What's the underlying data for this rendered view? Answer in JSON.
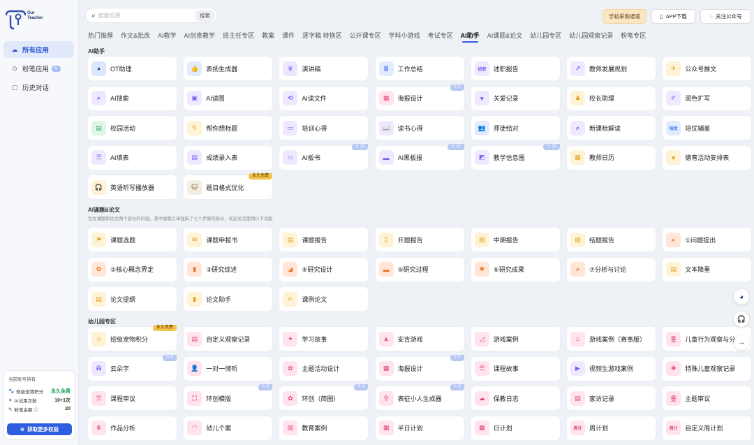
{
  "logo": {
    "line1": "Our",
    "line2": "Teacher"
  },
  "sidebar": {
    "items": [
      {
        "label": "所有应用",
        "icon": "cloud-icon",
        "active": true
      },
      {
        "label": "粉笔应用",
        "icon": "pin-icon",
        "badge": "✎",
        "active": false
      },
      {
        "label": "历史对话",
        "icon": "chat-history-icon",
        "active": false
      }
    ]
  },
  "account": {
    "title": "当前账号持有",
    "rows": [
      {
        "key": "班级宠物积分",
        "value": "永久免费",
        "icon": "paw-icon"
      },
      {
        "key": "AI试用次数",
        "value": "10+1次",
        "icon": "star-icon"
      },
      {
        "key": "粉笔余额 ⓘ",
        "value": "20",
        "icon": "pen-icon"
      }
    ],
    "button": "获取更多权益"
  },
  "search": {
    "placeholder": "搜索应用",
    "button": "搜索"
  },
  "top_buttons": {
    "school": "学校采购通道",
    "app": "APP下载",
    "wx": "关注公众号"
  },
  "tabs": [
    "热门推荐",
    "作文&批改",
    "AI教学",
    "AI创意教学",
    "班主任专区",
    "教案",
    "课件",
    "逐字稿 转换区",
    "公开课专区",
    "学科小游戏",
    "考试专区",
    "AI助手",
    "AI课题&论文",
    "幼儿园专区",
    "幼儿园观察记录",
    "粉笔专区"
  ],
  "active_tab": "AI助手",
  "sections": [
    {
      "title": "AI助手",
      "desc": "",
      "cards": [
        {
          "label": "OT助理",
          "color": "#1f3a8a",
          "bg": "#dbe6ff",
          "glyph": "◕"
        },
        {
          "label": "表扬生成器",
          "color": "#3b6ef0",
          "bg": "#e3ebff",
          "glyph": "👍"
        },
        {
          "label": "演讲稿",
          "color": "#7a5cf0",
          "bg": "#ece6ff",
          "glyph": "♛"
        },
        {
          "label": "工作总结",
          "color": "#3b6ef0",
          "bg": "#e3ebff",
          "glyph": "≣"
        },
        {
          "label": "述职报告",
          "color": "#7a5cf0",
          "bg": "#efe9ff",
          "glyph": "述职"
        },
        {
          "label": "教师发展规划",
          "color": "#7a5cf0",
          "bg": "#efe9ff",
          "glyph": "↗"
        },
        {
          "label": "公众号推文",
          "color": "#e0a21f",
          "bg": "#fff3d6",
          "glyph": "✈"
        },
        {
          "label": "AI搜索",
          "color": "#7a5cf0",
          "bg": "#efe9ff",
          "glyph": "⌕"
        },
        {
          "label": "AI读图",
          "color": "#7a5cf0",
          "bg": "#efe9ff",
          "glyph": "▣"
        },
        {
          "label": "AI读文件",
          "color": "#7a5cf0",
          "bg": "#efe9ff",
          "glyph": "⟲"
        },
        {
          "label": "海报设计",
          "color": "#e0467a",
          "bg": "#ffe4ee",
          "glyph": "▦",
          "badge": "✎ 1"
        },
        {
          "label": "关爱记录",
          "color": "#7a5cf0",
          "bg": "#efe9ff",
          "glyph": "♥"
        },
        {
          "label": "校长助理",
          "color": "#e0a21f",
          "bg": "#fff3d6",
          "glyph": "♟"
        },
        {
          "label": "润色扩写",
          "color": "#7a5cf0",
          "bg": "#efe9ff",
          "glyph": "✐"
        },
        {
          "label": "校园活动",
          "color": "#2fa86a",
          "bg": "#dff5e8",
          "glyph": "▤"
        },
        {
          "label": "帮你想标题",
          "color": "#e0a21f",
          "bg": "#fff3d6",
          "glyph": "✎"
        },
        {
          "label": "培训心得",
          "color": "#7a5cf0",
          "bg": "#efe9ff",
          "glyph": "▭"
        },
        {
          "label": "读书心得",
          "color": "#7a5cf0",
          "bg": "#efe9ff",
          "glyph": "📖"
        },
        {
          "label": "师徒结对",
          "color": "#3b6ef0",
          "bg": "#e3ebff",
          "glyph": "👥"
        },
        {
          "label": "新课标解读",
          "color": "#7a5cf0",
          "bg": "#efe9ff",
          "glyph": "⌕"
        },
        {
          "label": "培优辅差",
          "color": "#3b6ef0",
          "bg": "#e3ebff",
          "glyph": "培优"
        },
        {
          "label": "AI填表",
          "color": "#7a5cf0",
          "bg": "#efe9ff",
          "glyph": "☰"
        },
        {
          "label": "成绩录入表",
          "color": "#7a5cf0",
          "bg": "#efe9ff",
          "glyph": "▤"
        },
        {
          "label": "AI板书",
          "color": "#7a5cf0",
          "bg": "#efe9ff",
          "glyph": "▭",
          "badge": "✎ 10"
        },
        {
          "label": "AI黑板报",
          "color": "#7a5cf0",
          "bg": "#efe9ff",
          "glyph": "▬",
          "badge": "✎ 10"
        },
        {
          "label": "教学信息图",
          "color": "#7a5cf0",
          "bg": "#efe9ff",
          "glyph": "◩",
          "badge": "✎ 10"
        },
        {
          "label": "教师日历",
          "color": "#e0a21f",
          "bg": "#fff3d6",
          "glyph": "▦"
        },
        {
          "label": "德育活动安排表",
          "color": "#e0a21f",
          "bg": "#fff3d6",
          "glyph": "♥"
        },
        {
          "label": "英语听写播放器",
          "color": "#e0a21f",
          "bg": "#fff3d6",
          "glyph": "🎧"
        },
        {
          "label": "题目格式优化",
          "color": "#8a6a3a",
          "bg": "#f3ede2",
          "glyph": "🐱",
          "badge": "永久免费",
          "gold": true
        }
      ]
    },
    {
      "title": "AI课题&论文",
      "desc": "包含课题和论文两个部分的内容。其中课题又单独拆了七个步骤的拆分，欢迎灵活使用以下功能",
      "cards": [
        {
          "label": "课题选题",
          "color": "#e0a21f",
          "bg": "#fff3d6",
          "glyph": "⚑"
        },
        {
          "label": "课题申报书",
          "color": "#e0a21f",
          "bg": "#fff3d6",
          "glyph": "✉"
        },
        {
          "label": "课题报告",
          "color": "#e0a21f",
          "bg": "#fff3d6",
          "glyph": "▤"
        },
        {
          "label": "开题报告",
          "color": "#e0a21f",
          "bg": "#fff3d6",
          "glyph": "♖"
        },
        {
          "label": "中期报告",
          "color": "#e0a21f",
          "bg": "#fff3d6",
          "glyph": "▧"
        },
        {
          "label": "结题报告",
          "color": "#e0a21f",
          "bg": "#fff3d6",
          "glyph": "▨"
        },
        {
          "label": "①问题提出",
          "color": "#e8742a",
          "bg": "#ffe6d6",
          "glyph": "⌕"
        },
        {
          "label": "②核心概念界定",
          "color": "#e8742a",
          "bg": "#ffe6d6",
          "glyph": "✿"
        },
        {
          "label": "③研究综述",
          "color": "#e8742a",
          "bg": "#ffe6d6",
          "glyph": "▮"
        },
        {
          "label": "④研究设计",
          "color": "#e8742a",
          "bg": "#ffe6d6",
          "glyph": "◢"
        },
        {
          "label": "⑤研究过程",
          "color": "#e8742a",
          "bg": "#ffe6d6",
          "glyph": "▬"
        },
        {
          "label": "⑥研究成果",
          "color": "#e8742a",
          "bg": "#ffe6d6",
          "glyph": "✺"
        },
        {
          "label": "⑦分析与讨论",
          "color": "#e8742a",
          "bg": "#ffe6d6",
          "glyph": "⌕"
        },
        {
          "label": "文本降重",
          "color": "#e0a21f",
          "bg": "#fff3d6",
          "glyph": "▤"
        },
        {
          "label": "论文提纲",
          "color": "#e0a21f",
          "bg": "#fff3d6",
          "glyph": "▤"
        },
        {
          "label": "论文助手",
          "color": "#e0a21f",
          "bg": "#fff3d6",
          "glyph": "▮"
        },
        {
          "label": "课例论文",
          "color": "#e0a21f",
          "bg": "#fff3d6",
          "glyph": "✍"
        }
      ]
    },
    {
      "title": "幼儿园专区",
      "desc": "",
      "cards": [
        {
          "label": "班级宠物积分",
          "color": "#e0a21f",
          "bg": "#fff3d6",
          "glyph": "☺",
          "badge": "永久免费",
          "gold": true
        },
        {
          "label": "自定义观察记录",
          "color": "#e0467a",
          "bg": "#ffe4ee",
          "glyph": "▤"
        },
        {
          "label": "学习故事",
          "color": "#e0467a",
          "bg": "#ffe4ee",
          "glyph": "✦"
        },
        {
          "label": "安吉游戏",
          "color": "#e0467a",
          "bg": "#ffe4ee",
          "glyph": "⩓"
        },
        {
          "label": "游戏案例",
          "color": "#e0467a",
          "bg": "#ffe4ee",
          "glyph": "◿"
        },
        {
          "label": "游戏案例（赛事版）",
          "color": "#e0467a",
          "bg": "#ffe4ee",
          "glyph": "⌂"
        },
        {
          "label": "儿童行为观察与分析",
          "color": "#e0467a",
          "bg": "#ffe4ee",
          "glyph": "웃"
        },
        {
          "label": "云朵字",
          "color": "#7a5cf0",
          "bg": "#efe9ff",
          "glyph": "ᕱ",
          "badge": "✎ 5"
        },
        {
          "label": "一对一倾听",
          "color": "#e0467a",
          "bg": "#ffe4ee",
          "glyph": "👤"
        },
        {
          "label": "主题活动设计",
          "color": "#e0467a",
          "bg": "#ffe4ee",
          "glyph": "✿"
        },
        {
          "label": "海报设计",
          "color": "#e0467a",
          "bg": "#ffe4ee",
          "glyph": "▦",
          "badge": "✎ 5"
        },
        {
          "label": "课程故事",
          "color": "#e0467a",
          "bg": "#ffe4ee",
          "glyph": "☰"
        },
        {
          "label": "视频生游戏案例",
          "color": "#7a5cf0",
          "bg": "#efe9ff",
          "glyph": "▶"
        },
        {
          "label": "特殊儿童观察记录",
          "color": "#e0467a",
          "bg": "#ffe4ee",
          "glyph": "✚"
        },
        {
          "label": "课程审议",
          "color": "#e0467a",
          "bg": "#ffe4ee",
          "glyph": "☰"
        },
        {
          "label": "环创模版",
          "color": "#e0467a",
          "bg": "#ffe4ee",
          "glyph": "⛶",
          "badge": "✎ 5"
        },
        {
          "label": "环创（简图）",
          "color": "#e0467a",
          "bg": "#ffe4ee",
          "glyph": "✿",
          "badge": "✎ 1"
        },
        {
          "label": "表征小人生成器",
          "color": "#e0467a",
          "bg": "#ffe4ee",
          "glyph": "⚲",
          "badge": "✎ 5"
        },
        {
          "label": "保教日志",
          "color": "#e0467a",
          "bg": "#ffe4ee",
          "glyph": "☁"
        },
        {
          "label": "家访记录",
          "color": "#e0467a",
          "bg": "#ffe4ee",
          "glyph": "▤"
        },
        {
          "label": "主题审议",
          "color": "#e0467a",
          "bg": "#ffe4ee",
          "glyph": "웃"
        },
        {
          "label": "作品分析",
          "color": "#e0467a",
          "bg": "#ffe4ee",
          "glyph": "♛"
        },
        {
          "label": "幼儿个案",
          "color": "#e0467a",
          "bg": "#ffe4ee",
          "glyph": "◠"
        },
        {
          "label": "教育案例",
          "color": "#e0467a",
          "bg": "#ffe4ee",
          "glyph": "▥"
        },
        {
          "label": "半日计划",
          "color": "#e0467a",
          "bg": "#ffe4ee",
          "glyph": "▦"
        },
        {
          "label": "日计划",
          "color": "#e0467a",
          "bg": "#ffe4ee",
          "glyph": "▦"
        },
        {
          "label": "周计划",
          "color": "#e0467a",
          "bg": "#ffe4ee",
          "glyph": "周计"
        },
        {
          "label": "自定义周计划",
          "color": "#e0467a",
          "bg": "#ffe4ee",
          "glyph": "周计"
        }
      ]
    }
  ],
  "floating": [
    {
      "icon": "robot-icon",
      "glyph": "◕"
    },
    {
      "icon": "headset-icon",
      "glyph": "🎧"
    },
    {
      "icon": "arrow-right-icon",
      "glyph": "→"
    }
  ]
}
